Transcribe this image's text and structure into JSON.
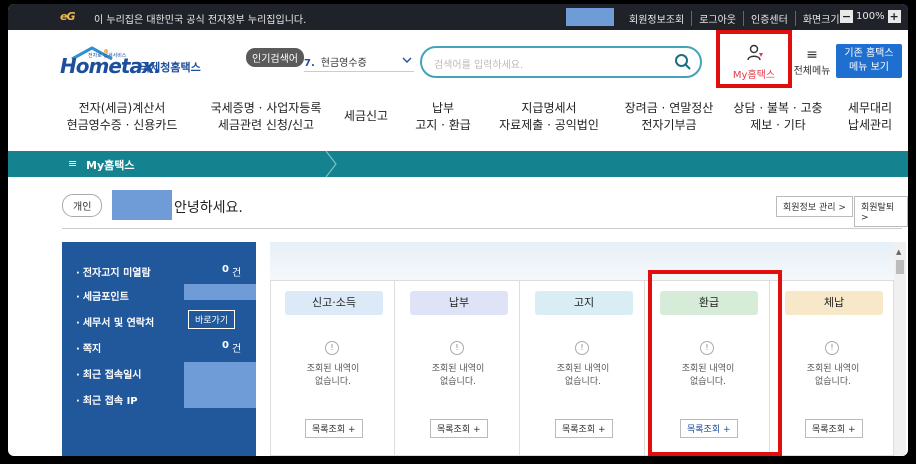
{
  "gov_bar": {
    "logo_text": "eG",
    "notice": "이 누리집은 대한민국 공식 전자정부 누리집입니다.",
    "links": [
      "회원정보조회",
      "로그아웃",
      "인증센터",
      "화면크기"
    ],
    "zoom": "100%"
  },
  "header": {
    "logo_text": "Hometax.",
    "logo_tagline": "국세청홈택스",
    "logo_small": "전자로 납세서비스",
    "popular_label": "인기검색어",
    "popular_rank": "7.",
    "popular_term": "현금영수증",
    "search_placeholder": "검색어를 입력하세요.",
    "my_hometax": "My홈택스",
    "all_menu": "전체메뉴",
    "old_menu_line1": "기존 홈택스",
    "old_menu_line2": "메뉴 보기"
  },
  "gnb": [
    {
      "l1": "전자(세금)계산서",
      "l2": "현금영수증 · 신용카드"
    },
    {
      "l1": "국세증명 · 사업자등록",
      "l2": "세금관련 신청/신고"
    },
    {
      "l1": "세금신고",
      "l2": ""
    },
    {
      "l1": "납부",
      "l2": "고지 · 환급"
    },
    {
      "l1": "지급명세서",
      "l2": "자료제출 · 공익법인"
    },
    {
      "l1": "장려금 · 연말정산",
      "l2": "전자기부금"
    },
    {
      "l1": "상담 · 불복 · 고충",
      "l2": "제보 · 기타"
    },
    {
      "l1": "세무대리",
      "l2": "납세관리"
    }
  ],
  "my_bar": {
    "title": "My홈택스"
  },
  "greeting": {
    "badge": "개인",
    "text": "안녕하세요.",
    "member_btn": "회원정보 관리 >",
    "withdraw_btn": "회원탈퇴 >"
  },
  "left_panel": {
    "unread_label": "전자고지 미열람",
    "unread_count": "0",
    "unread_unit": "건",
    "point_label": "세금포인트",
    "agent_label": "세무서 및 연락처",
    "goto_btn": "바로가기",
    "note_label": "쪽지",
    "note_count": "0",
    "note_unit": "건",
    "last_access_label": "최근 접속일시",
    "last_ip_label": "최근 접속 IP"
  },
  "cards": [
    {
      "title": "신고·소득",
      "color": "#dbeaf6",
      "msg1": "조회된 내역이",
      "msg2": "없습니다.",
      "btn": "목록조회 +"
    },
    {
      "title": "납부",
      "color": "#dfe3f7",
      "msg1": "조회된 내역이",
      "msg2": "없습니다.",
      "btn": "목록조회 +"
    },
    {
      "title": "고지",
      "color": "#d8eef4",
      "msg1": "조회된 내역이",
      "msg2": "없습니다.",
      "btn": "목록조회 +"
    },
    {
      "title": "환급",
      "color": "#d6ecd9",
      "msg1": "조회된 내역이",
      "msg2": "없습니다.",
      "btn": "목록조회 +"
    },
    {
      "title": "체납",
      "color": "#f6e8c9",
      "msg1": "조회된 내역이",
      "msg2": "없습니다.",
      "btn": "목록조회 +"
    }
  ],
  "colors": {
    "brand": "#1d4f9b",
    "teal": "#14838f",
    "panel": "#21589c",
    "highlight": "#e10e0e"
  }
}
